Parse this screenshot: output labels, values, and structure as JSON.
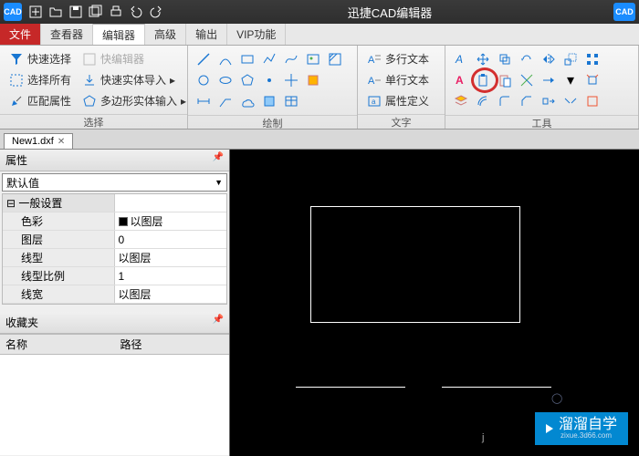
{
  "app": {
    "title": "迅捷CAD编辑器",
    "icon_label": "CAD",
    "right_badge": "CAD"
  },
  "menus": {
    "file": "文件",
    "viewer": "查看器",
    "editor": "编辑器",
    "advanced": "高级",
    "output": "输出",
    "vip": "VIP功能"
  },
  "ribbon": {
    "select": {
      "label": "选择",
      "quick_select": "快速选择",
      "quick_editor": "快编辑器",
      "select_all": "选择所有",
      "quick_entity_import": "快速实体导入",
      "match_props": "匹配属性",
      "polygon_entity_input": "多边形实体输入"
    },
    "draw": {
      "label": "绘制"
    },
    "text": {
      "label": "文字",
      "mtext": "多行文本",
      "stext": "单行文本",
      "attrdef": "属性定义"
    },
    "tools": {
      "label": "工具"
    }
  },
  "doc": {
    "tab1": "New1.dxf"
  },
  "props": {
    "panel_title": "属性",
    "combo": "默认值",
    "section_general": "一般设置",
    "color_label": "色彩",
    "color_val": "以图层",
    "layer_label": "图层",
    "layer_val": "0",
    "ltype_label": "线型",
    "ltype_val": "以图层",
    "ltscale_label": "线型比例",
    "ltscale_val": "1",
    "lweight_label": "线宽",
    "lweight_val": "以图层"
  },
  "fav": {
    "title": "收藏夹",
    "col_name": "名称",
    "col_path": "路径"
  },
  "watermark": {
    "brand": "溜溜自学",
    "url": "zixue.3d66.com",
    "j": "j"
  }
}
